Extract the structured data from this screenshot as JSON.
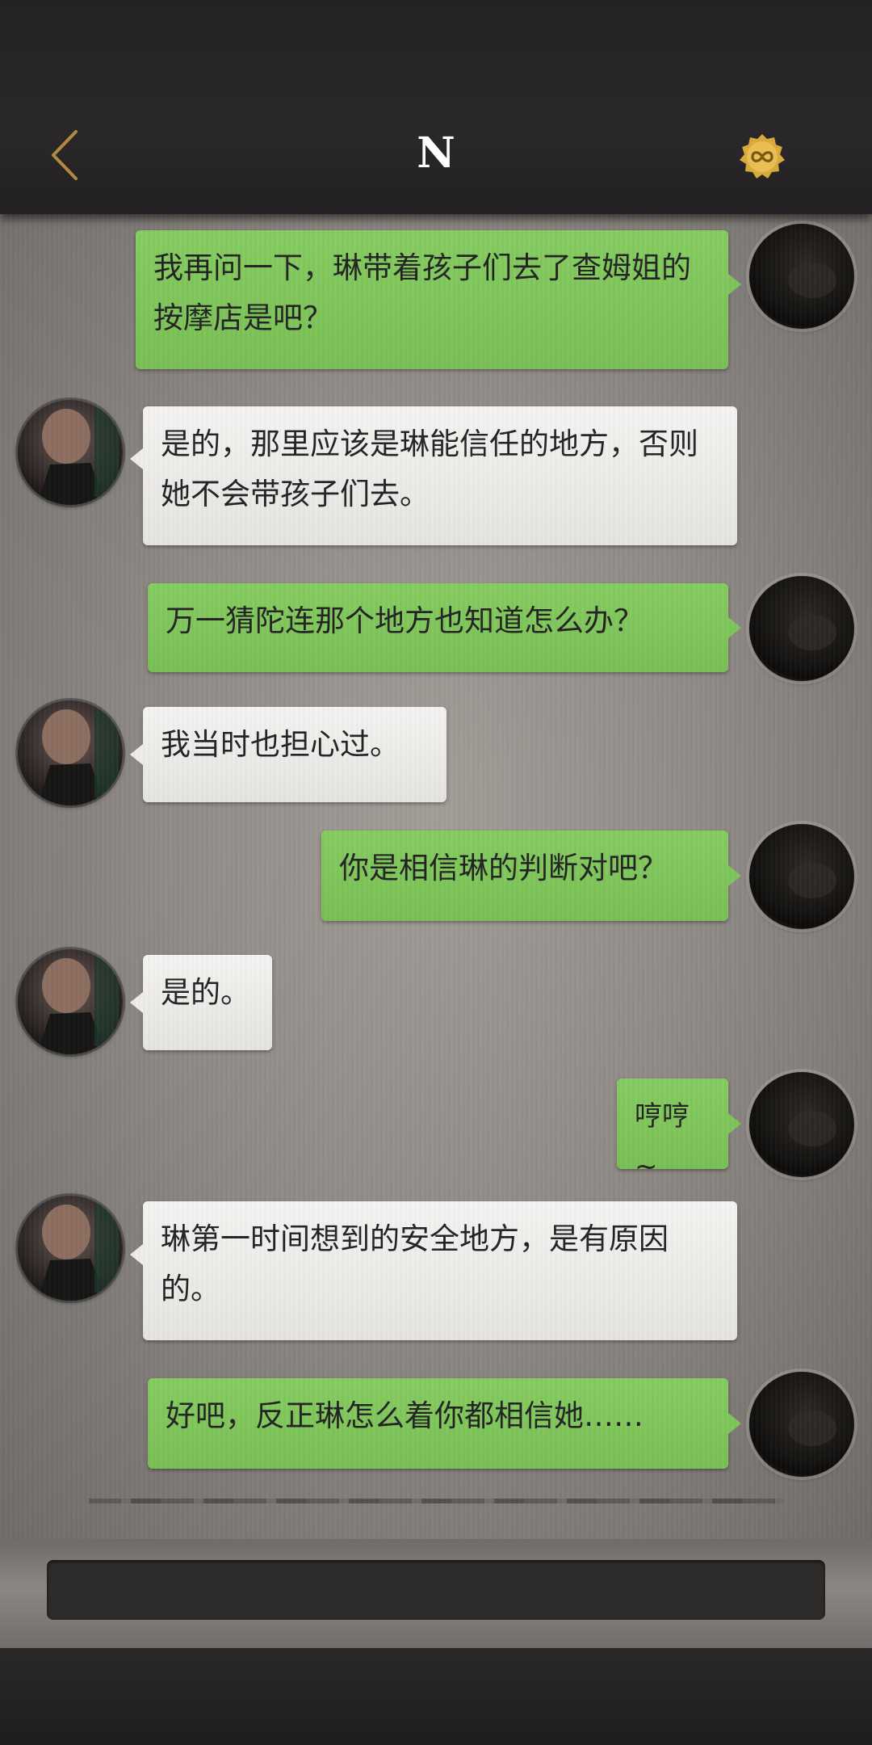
{
  "header": {
    "title": "N",
    "back_icon": "chevron-left-icon",
    "badge_icon": "infinity-badge-icon",
    "accent_color": "#c59a4a"
  },
  "messages": [
    {
      "from": "me",
      "text": "我再问一下，琳带着孩子们去了查姆姐的按摩店是吧？"
    },
    {
      "from": "other",
      "text": "是的，那里应该是琳能信任的地方，否则她不会带孩子们去。"
    },
    {
      "from": "me",
      "text": "万一猜陀连那个地方也知道怎么办？"
    },
    {
      "from": "other",
      "text": "我当时也担心过。"
    },
    {
      "from": "me",
      "text": "你是相信琳的判断对吧？"
    },
    {
      "from": "other",
      "text": "是的。"
    },
    {
      "from": "me",
      "text": "哼哼~"
    },
    {
      "from": "other",
      "text": "琳第一时间想到的安全地方，是有原因的。"
    },
    {
      "from": "me",
      "text": "好吧，反正琳怎么着你都相信她……"
    }
  ],
  "colors": {
    "me_bubble": "#7ec45a",
    "other_bubble": "#eeedeb"
  }
}
